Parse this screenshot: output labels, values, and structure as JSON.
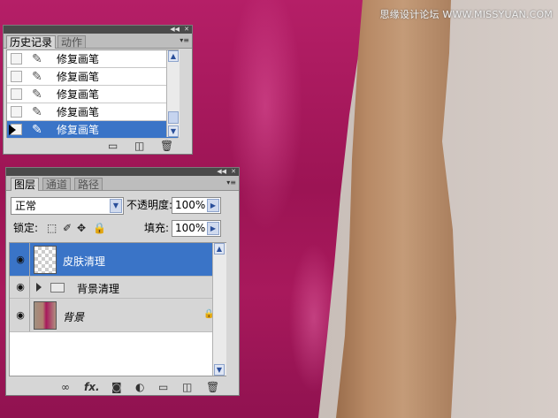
{
  "watermark": "思缘设计论坛 WWW.MISSYUAN.COM",
  "colors": {
    "selection": "#3a74c7",
    "panel_bg": "#d6d6d6",
    "titlebar": "#4a4a4a",
    "dress": "#a8195c"
  },
  "history_panel": {
    "tabs": [
      {
        "label": "历史记录",
        "active": true
      },
      {
        "label": "动作",
        "active": false
      }
    ],
    "items": [
      {
        "label": "修复画笔",
        "icon": "healing-brush-icon",
        "selected": false
      },
      {
        "label": "修复画笔",
        "icon": "healing-brush-icon",
        "selected": false
      },
      {
        "label": "修复画笔",
        "icon": "healing-brush-icon",
        "selected": false
      },
      {
        "label": "修复画笔",
        "icon": "healing-brush-icon",
        "selected": false
      },
      {
        "label": "修复画笔",
        "icon": "healing-brush-icon",
        "selected": true
      }
    ],
    "footer_icons": [
      "new-document-from-state-icon",
      "snapshot-icon",
      "trash-icon"
    ]
  },
  "layers_panel": {
    "tabs": [
      {
        "label": "图层",
        "active": true
      },
      {
        "label": "通道",
        "active": false
      },
      {
        "label": "路径",
        "active": false
      }
    ],
    "blend_mode": "正常",
    "opacity_label": "不透明度:",
    "opacity_value": "100%",
    "lock_label": "锁定:",
    "fill_label": "填充:",
    "fill_value": "100%",
    "layers": [
      {
        "name": "皮肤清理",
        "type": "pixel",
        "selected": true,
        "visible": true
      },
      {
        "name": "背景清理",
        "type": "group",
        "selected": false,
        "visible": true
      },
      {
        "name": "背景",
        "type": "background",
        "selected": false,
        "visible": true,
        "locked": true
      }
    ],
    "footer_icons": [
      "link-icon",
      "fx-icon",
      "mask-icon",
      "adjustment-icon",
      "group-icon",
      "new-layer-icon",
      "trash-icon"
    ],
    "fx_label": "fx."
  }
}
